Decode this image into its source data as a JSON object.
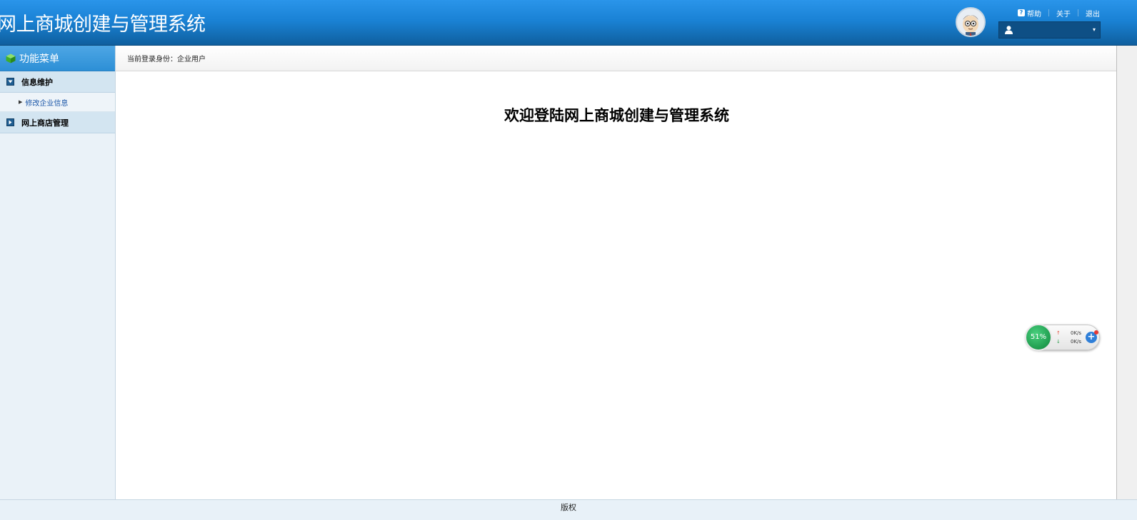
{
  "header": {
    "app_title": "网上商城创建与管理系统",
    "help_label": "帮助",
    "about_label": "关于",
    "logout_label": "退出",
    "user_select_value": ""
  },
  "sidebar": {
    "title": "功能菜单",
    "groups": [
      {
        "label": "信息维护",
        "expanded": true,
        "items": [
          {
            "label": "修改企业信息"
          }
        ]
      },
      {
        "label": "网上商店管理",
        "expanded": false,
        "items": []
      }
    ]
  },
  "breadcrumb": {
    "text": "当前登录身份：企业用户"
  },
  "main": {
    "welcome": "欢迎登陆网上商城创建与管理系统"
  },
  "footer": {
    "text": "版权"
  },
  "speed_widget": {
    "percent": "51%",
    "upload": "0K/s",
    "download": "0K/s"
  },
  "colors": {
    "header_top": "#2a95ea",
    "header_bottom": "#0f5f9e",
    "sidebar_bg": "#eaf2f8",
    "link": "#1a56a8"
  }
}
